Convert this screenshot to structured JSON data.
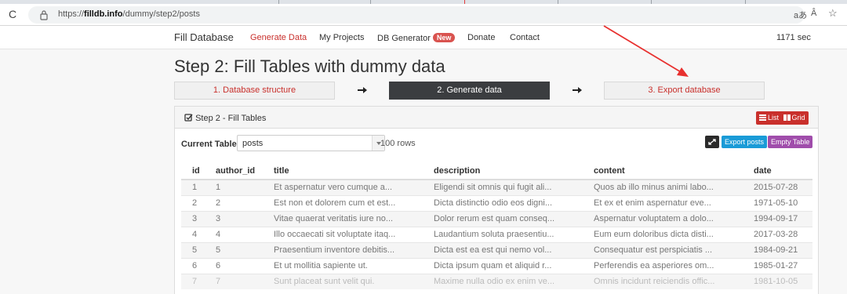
{
  "browser": {
    "url_prefix": "https://",
    "url_host": "filldb.info",
    "url_path": "/dummy/step2/posts",
    "translate_icon": "aあ",
    "read_aloud_icon": "Â",
    "favorite_icon": "☆",
    "reload_icon": "C"
  },
  "nav": {
    "brand": "Fill Database",
    "links": [
      {
        "label": "Generate Data"
      },
      {
        "label": "My Projects"
      },
      {
        "label": "DB Generator"
      },
      {
        "label": "Donate"
      },
      {
        "label": "Contact"
      }
    ],
    "new_badge": "New",
    "timer": "1171 sec"
  },
  "page": {
    "title": "Step 2: Fill Tables with dummy data"
  },
  "steps": [
    {
      "label": "1. Database structure"
    },
    {
      "label": "2. Generate data"
    },
    {
      "label": "3. Export database"
    }
  ],
  "panel": {
    "title": "Step 2 - Fill Tables",
    "view_list": "List",
    "view_grid": "Grid",
    "current_table_label": "Current Table:",
    "current_table_value": "posts",
    "rows_count": "100 rows",
    "export_button": "Export posts",
    "empty_button": "Empty Table"
  },
  "table": {
    "headers": [
      "id",
      "author_id",
      "title",
      "description",
      "content",
      "date"
    ],
    "rows": [
      [
        "1",
        "1",
        "Et aspernatur vero cumque a...",
        "Eligendi sit omnis qui fugit ali...",
        "Quos ab illo minus animi labo...",
        "2015-07-28"
      ],
      [
        "2",
        "2",
        "Est non et dolorem cum et est...",
        "Dicta distinctio odio eos digni...",
        "Et ex et enim aspernatur eve...",
        "1971-05-10"
      ],
      [
        "3",
        "3",
        "Vitae quaerat veritatis iure no...",
        "Dolor rerum est quam conseq...",
        "Aspernatur voluptatem a dolo...",
        "1994-09-17"
      ],
      [
        "4",
        "4",
        "Illo occaecati sit voluptate itaq...",
        "Laudantium soluta praesentiu...",
        "Eum eum doloribus dicta disti...",
        "2017-03-28"
      ],
      [
        "5",
        "5",
        "Praesentium inventore debitis...",
        "Dicta est ea est qui nemo vol...",
        "Consequatur est perspiciatis ...",
        "1984-09-21"
      ],
      [
        "6",
        "6",
        "Et ut mollitia sapiente ut.",
        "Dicta ipsum quam et aliquid r...",
        "Perferendis ea asperiores om...",
        "1985-01-27"
      ],
      [
        "7",
        "7",
        "Sunt placeat sunt velit qui.",
        "Maxime nulla odio ex enim ve...",
        "Omnis incidunt reiciendis offic...",
        "1981-10-05"
      ]
    ]
  },
  "colors": {
    "accent_red": "#c9302c",
    "export_blue": "#1a9bd7",
    "empty_purple": "#a04dab",
    "annotation_arrow": "#e8312f"
  }
}
